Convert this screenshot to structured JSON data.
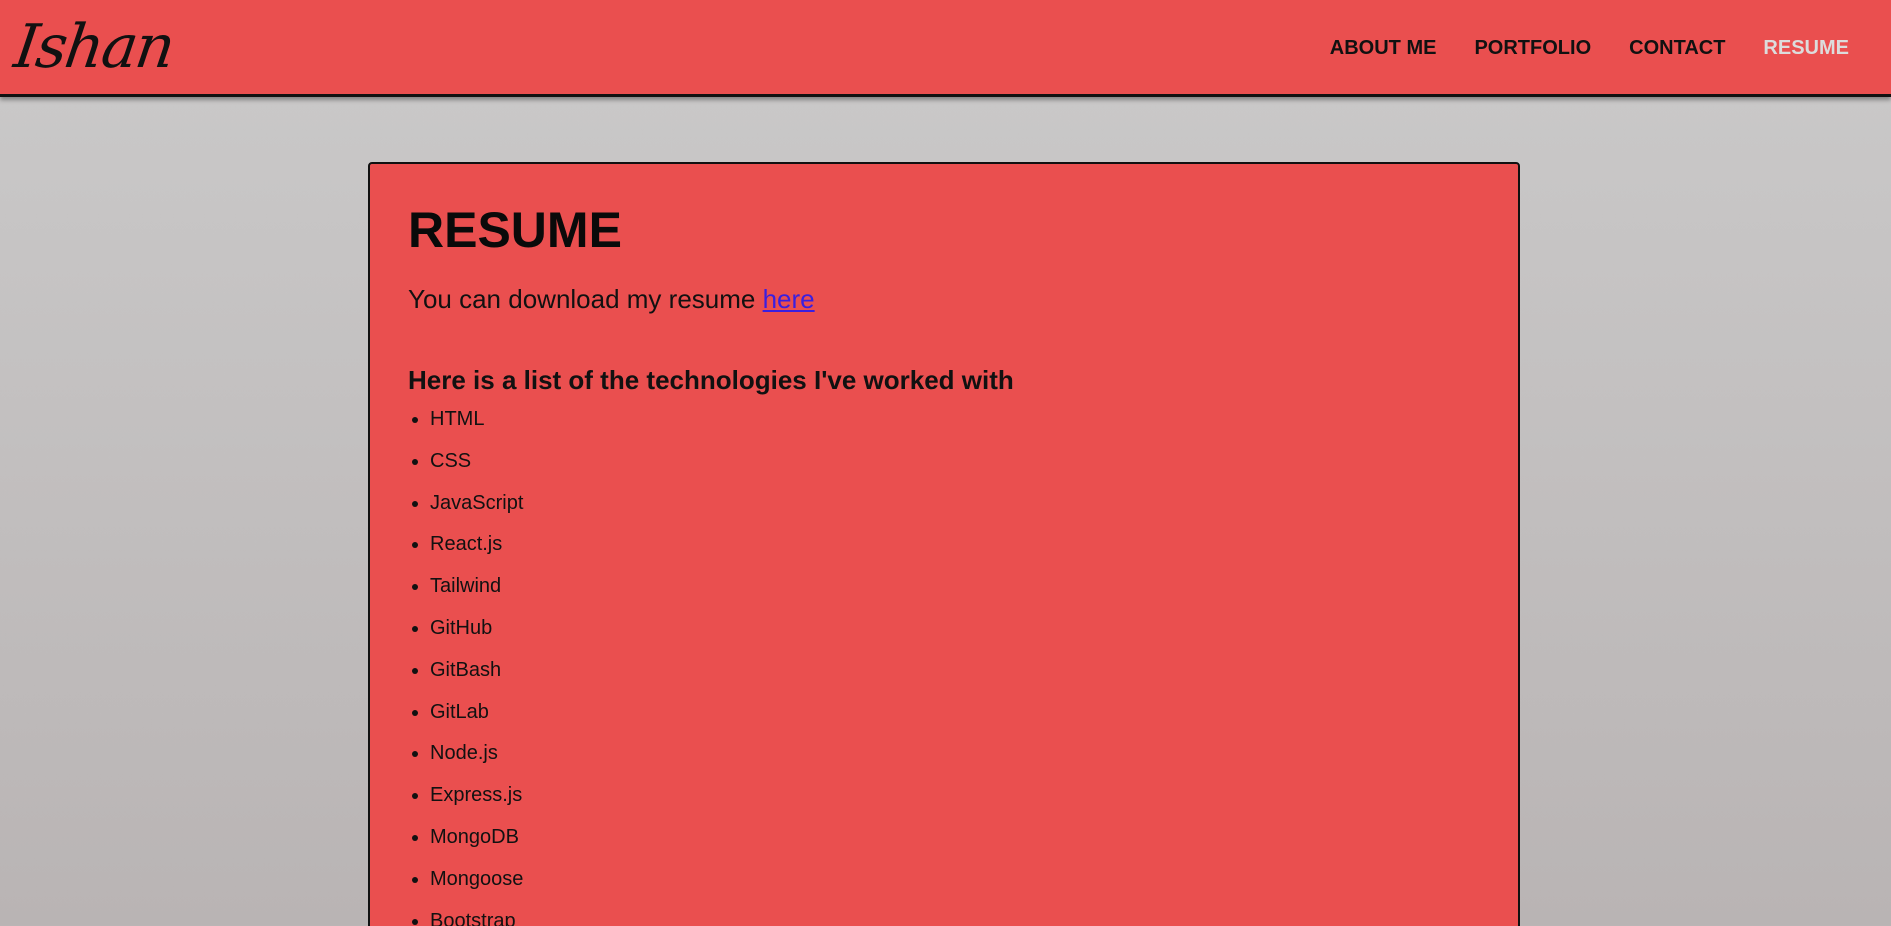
{
  "header": {
    "logo": "Ishan",
    "nav": [
      {
        "label": "ABOUT ME"
      },
      {
        "label": "PORTFOLIO"
      },
      {
        "label": "CONTACT"
      },
      {
        "label": "RESUME",
        "active": true
      }
    ]
  },
  "resume": {
    "title": "RESUME",
    "download_text": "You can download my resume ",
    "download_link": "here",
    "tech_heading": "Here is a list of the technologies I've worked with",
    "technologies": [
      "HTML",
      "CSS",
      "JavaScript",
      "React.js",
      "Tailwind",
      "GitHub",
      "GitBash",
      "GitLab",
      "Node.js",
      "Express.js",
      "MongoDB",
      "Mongoose",
      "Bootstrap"
    ]
  },
  "colors": {
    "brand_red": "#ea4f4f",
    "active_nav": "#dcdcdc",
    "link": "#3a1fe0"
  }
}
